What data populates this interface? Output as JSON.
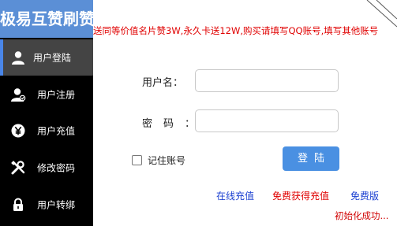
{
  "app": {
    "title": "极易互赞刷赞"
  },
  "notice": {
    "text": "送同等价值名片赞3W,永久卡送12W,购买请填写QQ账号,填写其他账号"
  },
  "sidebar": {
    "items": [
      {
        "label": "用户登陆",
        "icon": "user-icon",
        "active": true
      },
      {
        "label": "用户注册",
        "icon": "user-register-icon",
        "active": false
      },
      {
        "label": "用户充值",
        "icon": "yen-icon",
        "active": false
      },
      {
        "label": "修改密码",
        "icon": "tools-icon",
        "active": false
      },
      {
        "label": "用户转绑",
        "icon": "lock-icon",
        "active": false
      }
    ]
  },
  "form": {
    "username_label": "用户名：",
    "password_label": "密码",
    "password_colon": "：",
    "username_value": "",
    "password_value": "",
    "remember_label": "记住账号",
    "remember_checked": false,
    "login_label": "登陆"
  },
  "links": {
    "online_recharge": "在线充值",
    "free_recharge": "免费获得充值",
    "free_version": "免费版"
  },
  "status": {
    "text": "初始化成功..."
  },
  "colors": {
    "sidebar_bg": "#000000",
    "brand_bg": "#5b8fd6",
    "active_item_bg": "#444444",
    "accent": "#4a86e8",
    "notice_text": "#e00000",
    "login_button": "#4a90e2",
    "link_blue": "#1a3fd1",
    "link_red": "#e00000"
  }
}
